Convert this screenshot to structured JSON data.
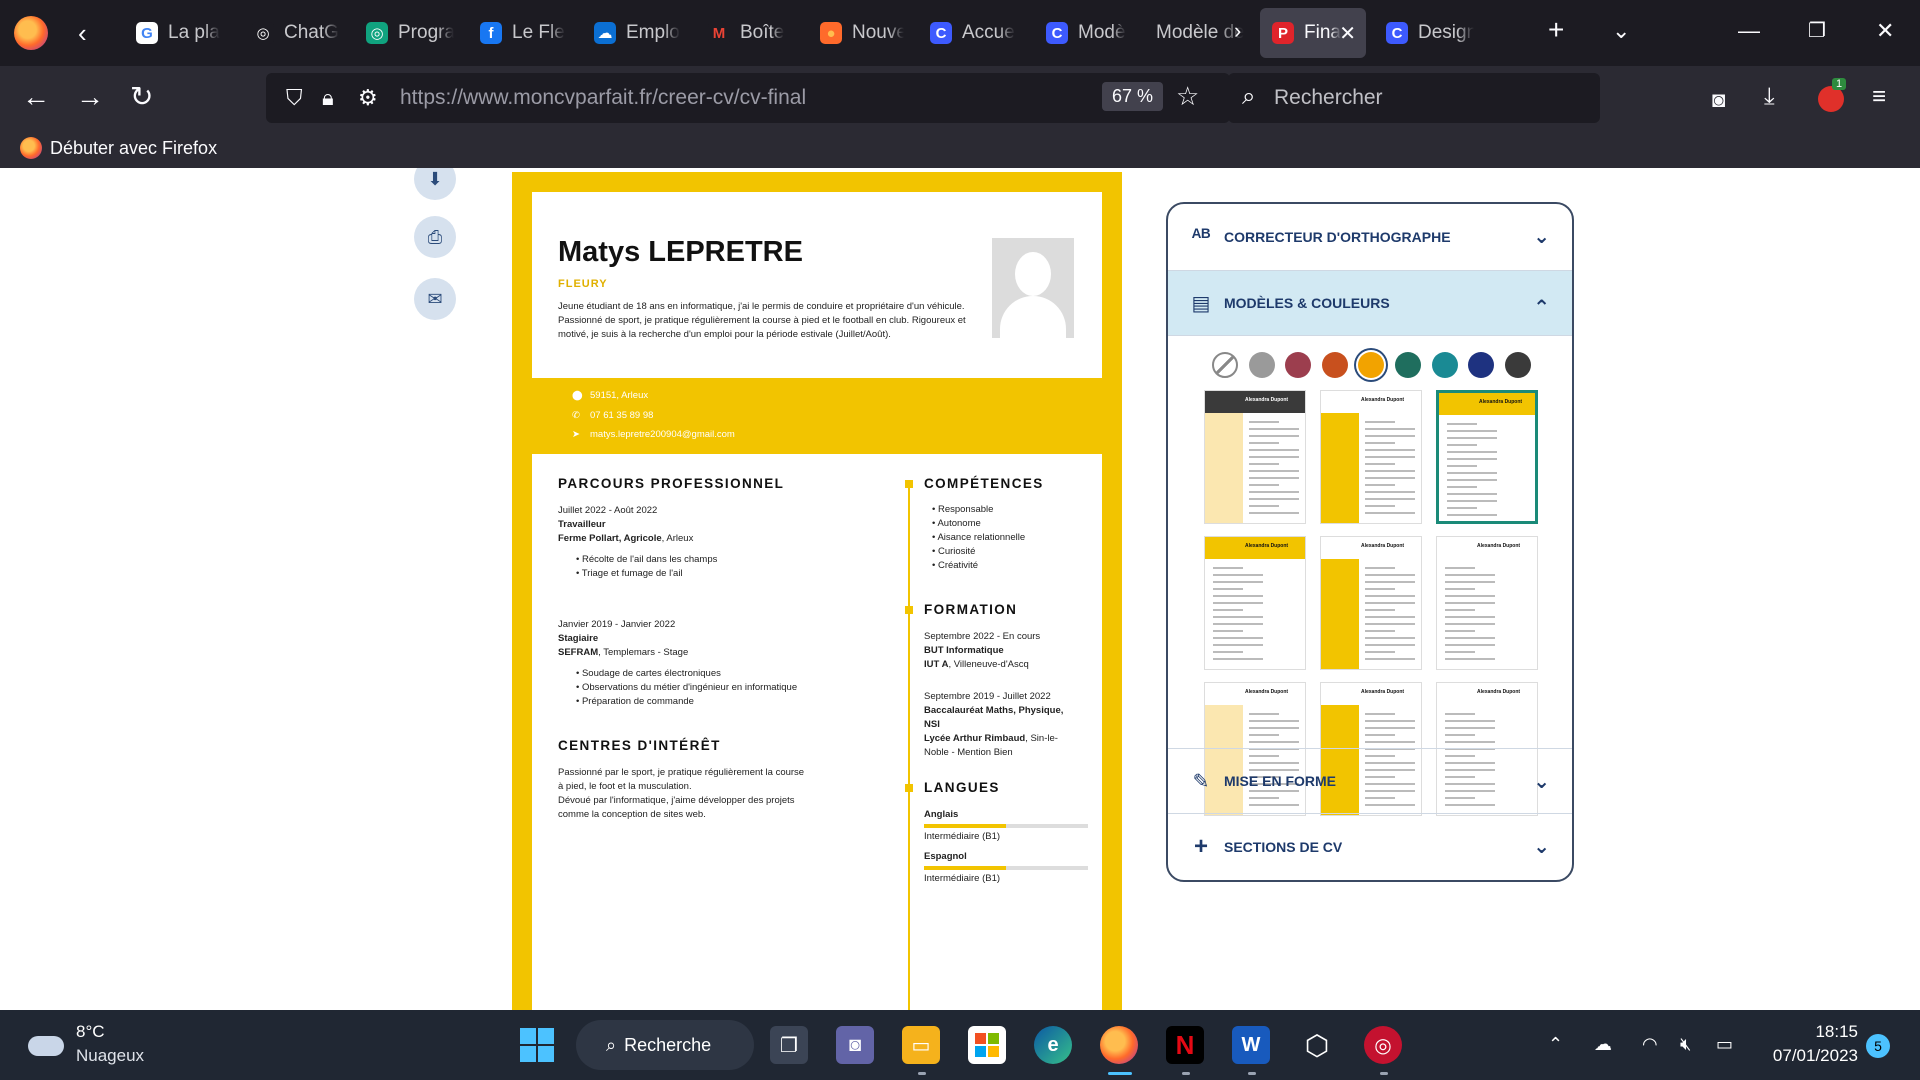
{
  "tabs": [
    {
      "label": "La pla",
      "fav": "G",
      "fav_color": "#ffffff",
      "fav_text": "#4285f4"
    },
    {
      "label": "ChatG",
      "fav": "◎",
      "fav_color": "#1c1b22",
      "fav_text": "#ffffff"
    },
    {
      "label": "Progra",
      "fav": "◎",
      "fav_color": "#10a37f",
      "fav_text": "#ffffff"
    },
    {
      "label": "Le Fle",
      "fav": "f",
      "fav_color": "#1877f2",
      "fav_text": "#ffffff"
    },
    {
      "label": "Emplo",
      "fav": "☁",
      "fav_color": "#0b6fd3",
      "fav_text": "#ffffff"
    },
    {
      "label": "Boîte",
      "fav": "M",
      "fav_color": "#1c1b22",
      "fav_text": "#ea4335"
    },
    {
      "label": "Nouve",
      "fav": "●",
      "fav_color": "#ff6a2b",
      "fav_text": "#ffbd4f"
    },
    {
      "label": "Accue",
      "fav": "C",
      "fav_color": "#3d5afe",
      "fav_text": "#ffffff"
    },
    {
      "label": "Modè",
      "fav": "C",
      "fav_color": "#3d5afe",
      "fav_text": "#ffffff"
    },
    {
      "label": "Modèle de",
      "fav": "",
      "fav_color": "transparent",
      "fav_text": "#ffffff"
    },
    {
      "label": "Fina",
      "fav": "P",
      "fav_color": "#e0242b",
      "fav_text": "#ffffff",
      "active": true
    },
    {
      "label": "Design",
      "fav": "C",
      "fav_color": "#3d5afe",
      "fav_text": "#ffffff"
    }
  ],
  "url": {
    "host": "https://www.moncvparfait.fr",
    "path": "/creer-cv/cv-final",
    "zoom": "67 %"
  },
  "search_placeholder": "Rechercher",
  "bookmark": "Débuter avec Firefox",
  "extension_badge": "1",
  "cv": {
    "name": "Matys LEPRETRE",
    "subtitle": "FLEURY",
    "about": "Jeune étudiant de 18 ans en informatique, j'ai le permis de conduire et propriétaire d'un véhicule. Passionné de sport, je pratique régulièrement la course à pied et le football en club. Rigoureux et motivé, je suis à la recherche d'un emploi pour la période estivale (Juillet/Août).",
    "contact": {
      "address": "59151, Arleux",
      "phone": "07 61 35 89 98",
      "email": "matys.lepretre200904@gmail.com"
    },
    "sections": {
      "parcours": "PARCOURS PROFESSIONNEL",
      "centres": "CENTRES D'INTÉRÊT",
      "competences": "COMPÉTENCES",
      "formation": "FORMATION",
      "langues": "LANGUES"
    },
    "jobs": [
      {
        "dates": "Juillet 2022 - Août 2022",
        "title": "Travailleur",
        "company": "Ferme Pollart, Agricole",
        "place": ", Arleux",
        "bullets": [
          "Récolte de l'ail dans les champs",
          "Triage et fumage de l'ail"
        ]
      },
      {
        "dates": "Janvier 2019 - Janvier 2022",
        "title": "Stagiaire",
        "company": "SEFRAM",
        "place": ", Templemars - Stage",
        "bullets": [
          "Soudage de cartes électroniques",
          "Observations du métier d'ingénieur en informatique",
          "Préparation de commande"
        ]
      }
    ],
    "interets": [
      "Passionné par le sport, je pratique régulièrement la course",
      "à pied, le foot et la musculation.",
      "Dévoué par l'informatique, j'aime développer des projets",
      "comme la conception de sites web."
    ],
    "competences": [
      "Responsable",
      "Autonome",
      "Aisance relationnelle",
      "Curiosité",
      "Créativité"
    ],
    "formations": [
      {
        "dates": "Septembre 2022 - En cours",
        "diploma": "BUT Informatique",
        "school": "IUT A",
        "place": ", Villeneuve-d'Ascq"
      },
      {
        "dates": "Septembre 2019 - Juillet 2022",
        "diploma": "Baccalauréat Maths, Physique,",
        "diploma2": "NSI",
        "school": "Lycée Arthur Rimbaud",
        "place": ", Sin-le-",
        "extra": "Noble - Mention Bien"
      }
    ],
    "langues": [
      {
        "name": "Anglais",
        "level": "Intermédiaire (B1)",
        "fill": 0.5
      },
      {
        "name": "Espagnol",
        "level": "Intermédiaire (B1)",
        "fill": 0.5
      }
    ]
  },
  "panel": {
    "correcteur": "CORRECTEUR D'ORTHOGRAPHE",
    "modeles": "MODÈLES & COULEURS",
    "mise_en_forme": "MISE EN FORME",
    "sections": "SECTIONS DE CV",
    "colors": [
      "none",
      "#9a9a9a",
      "#9c3e4e",
      "#c8501e",
      "#f2a300",
      "#1f6e5e",
      "#1a8a94",
      "#1e3280",
      "#3a3a3a"
    ],
    "selected_color": 4,
    "thumbnail_title": "Alexandra Dupont"
  },
  "taskbar": {
    "weather_temp": "8°C",
    "weather_desc": "Nuageux",
    "search": "Recherche",
    "time": "18:15",
    "date": "07/01/2023",
    "notif": "5"
  }
}
